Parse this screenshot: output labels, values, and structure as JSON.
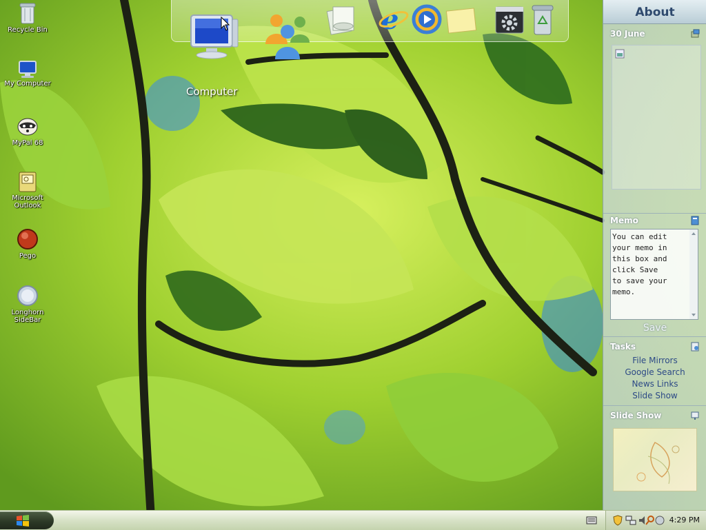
{
  "desktop": {
    "icons": [
      {
        "label": "Recycle Bin",
        "icon": "recycle-bin-icon"
      },
      {
        "label": "My Computer",
        "icon": "my-computer-icon"
      },
      {
        "label": "MyPal 68",
        "icon": "mypal-icon"
      },
      {
        "label": "Microsoft Outlook",
        "icon": "outlook-icon"
      },
      {
        "label": "Pego",
        "icon": "pego-icon"
      },
      {
        "label": "Longhorn SideBar",
        "icon": "longhorn-sidebar-icon"
      }
    ]
  },
  "dock": {
    "hover_label": "Computer",
    "items": [
      "computer-icon",
      "users-icon",
      "documents-icon",
      "internet-explorer-icon",
      "media-player-icon",
      "notes-icon",
      "settings-icon",
      "recycle-bin-icon"
    ]
  },
  "sidebar": {
    "title": "About",
    "date": "30 June",
    "memo": {
      "header": "Memo",
      "text": "You can edit\nyour memo in\nthis box and\nclick Save\nto save your\nmemo.",
      "save_label": "Save"
    },
    "tasks": {
      "header": "Tasks",
      "items": [
        "File Mirrors",
        "Google Search",
        "News Links",
        "Slide Show"
      ]
    },
    "slideshow": {
      "header": "Slide Show"
    }
  },
  "taskbar": {
    "start_icon": "windows-logo-icon",
    "clock": "4:29 PM"
  },
  "colors": {
    "sidebar_title": "#2f4a6e",
    "task_link": "#2d4a86",
    "taskbar": "#d7e2c6"
  }
}
